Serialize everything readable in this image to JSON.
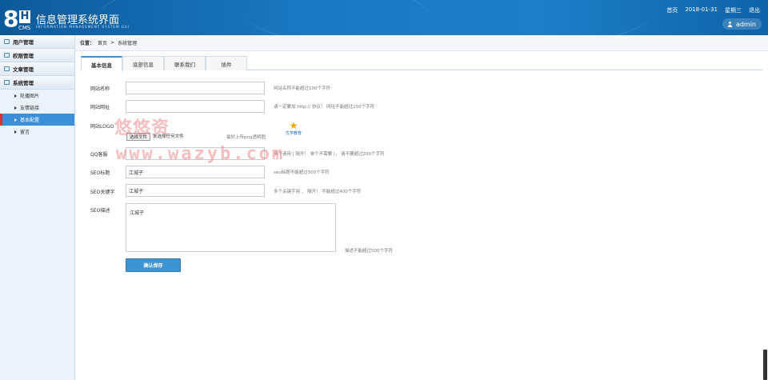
{
  "header": {
    "logo_8": "8",
    "logo_h": "H",
    "logo_cms": "CMS",
    "title": "信息管理系统界面",
    "subtitle": "INFORMATION MANAGEMENT SYSTEM GUI",
    "nav": [
      "首页",
      "2018-01-31",
      "星期三",
      "退出"
    ],
    "admin": "admin"
  },
  "sidebar": {
    "menus": [
      {
        "label": "用户管理",
        "icon": "user-menu-icon"
      },
      {
        "label": "权限管理",
        "icon": "permission-menu-icon"
      },
      {
        "label": "文章管理",
        "icon": "article-menu-icon"
      },
      {
        "label": "系统管理",
        "icon": "system-menu-icon"
      }
    ],
    "sub_items": [
      "轮播图片",
      "友情链接",
      "基本配置",
      "留言"
    ],
    "active_sub": "基本配置"
  },
  "breadcrumb": {
    "label": "位置：",
    "home": "首页",
    "sep": ">",
    "current": "系统管理"
  },
  "tabs": [
    "基本信息",
    "底部信息",
    "联系我们",
    "插件"
  ],
  "form": {
    "site_name": {
      "label": "网站名称",
      "value": "",
      "hint": "网站名称不能超过100个字符"
    },
    "site_url": {
      "label": "网站网址",
      "value": "",
      "hint": "请一定要加 http:// 协议！ 网址不能超过150个字符"
    },
    "site_logo": {
      "label": "网站LOGO",
      "button": "选择文件",
      "file_text": "未选择任何文件",
      "hint": "最好上传png透明图",
      "preview_text": "优学教育"
    },
    "qq": {
      "label": "QQ客服",
      "value": "",
      "hint": "多个请用 | 隔开！ 单个不需要 |， 请不要超过200个字符"
    },
    "seo_title": {
      "label": "SEO标题",
      "value": "江城子",
      "hint": "seo标题不能超过300个字符"
    },
    "seo_keywords": {
      "label": "SEO关键字",
      "value": "江城子",
      "hint": "多个关键字用 ， 隔开！ 不能超过400个字符"
    },
    "seo_desc": {
      "label": "SEO描述",
      "value": "江城子",
      "hint": "描述不能超过500个字符"
    },
    "save_label": "确认保存"
  },
  "watermark": {
    "line1": "悠悠资",
    "line2": "www.wazyb.com"
  }
}
